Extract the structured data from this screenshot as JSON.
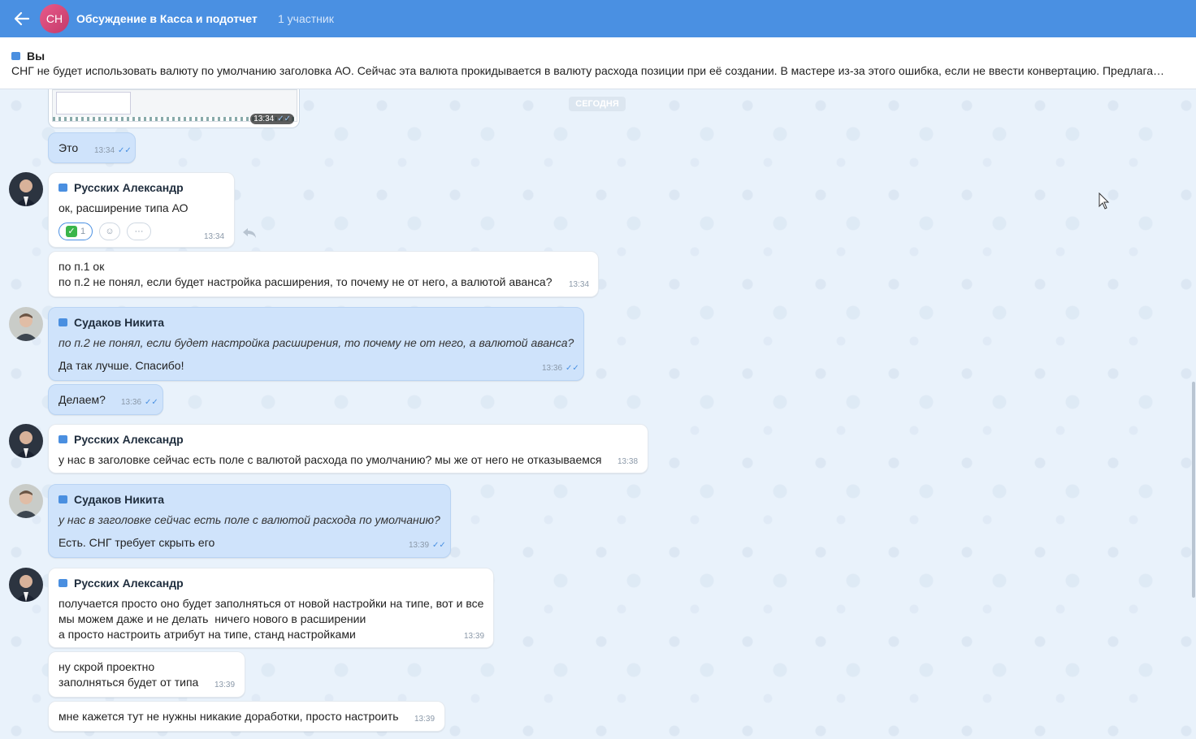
{
  "header": {
    "avatar_initials": "СН",
    "title": "Обсуждение в Касса и подотчет",
    "participants": "1 участник"
  },
  "pinned": {
    "author": "Вы",
    "text": "СНГ не будет использовать валюту по умолчанию заголовка АО. Сейчас эта валюта прокидывается в валюту расхода позиции при её создании. В мастере из-за этого ошибка, если не ввести конвертацию. Предлага…"
  },
  "chat": {
    "date_divider": "СЕГОДНЯ",
    "image_msg_time": "13:34",
    "messages": [
      {
        "text": "Это",
        "time": "13:34"
      },
      {
        "sender": "Русских Александр",
        "text": "ок, расширение типа АО",
        "time": "13:34",
        "reaction_count": "1"
      },
      {
        "text": "по п.1 ок\nпо п.2 не понял, если будет настройка расширения, то почему не от него, а валютой аванса?",
        "time": "13:34"
      },
      {
        "sender": "Судаков Никита",
        "quote": "по п.2 не понял, если будет настройка расширения, то почему не от него, а валютой аванса?",
        "text": "Да так лучше. Спасибо!",
        "time": "13:36"
      },
      {
        "text": "Делаем?",
        "time": "13:36"
      },
      {
        "sender": "Русских Александр",
        "text": "у нас в заголовке сейчас есть поле с валютой расхода по умолчанию? мы же от него не отказываемся",
        "time": "13:38"
      },
      {
        "sender": "Судаков Никита",
        "quote": "у нас в заголовке сейчас есть поле с валютой расхода по умолчанию?",
        "text": "Есть. СНГ требует скрыть его",
        "time": "13:39"
      },
      {
        "sender": "Русских Александр",
        "text": "получается просто оно будет заполняться от новой настройки на типе, вот и все\nмы можем даже и не делать  ничего нового в расширении\nа просто настроить атрибут на типе, станд настройками",
        "time": "13:39"
      },
      {
        "text": "ну скрой проектно\nзаполняться будет от типа",
        "time": "13:39"
      },
      {
        "text": "мне кажется тут не нужны никакие доработки, просто настроить",
        "time": "13:39"
      }
    ]
  },
  "colors": {
    "header_bg": "#4a90e2",
    "own_bubble": "#cfe3fb",
    "other_bubble": "#ffffff",
    "chat_bg": "#e9f2fb"
  }
}
